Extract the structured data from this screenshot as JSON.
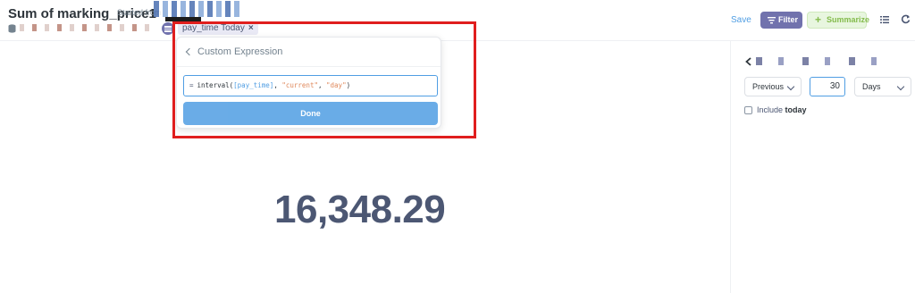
{
  "header": {
    "title": "Sum of marking_price1",
    "started_from": "Started from",
    "filter_pill": "pay_time Today",
    "filter_pill_close": "×",
    "save_label": "Save",
    "filter_label": "Filter",
    "summarize_label": "Summarize",
    "summarize_plus": "+",
    "colors": {
      "accent": "#509ee3",
      "filter": "#7172ad",
      "summarize": "#84bb4c"
    }
  },
  "popover": {
    "title": "Custom Expression",
    "expression": {
      "eq": "=",
      "fn": "interval(",
      "arg1": "[pay_time]",
      "sep1": ", ",
      "arg2": "\"current\"",
      "sep2": ", ",
      "arg3": "\"day\"",
      "close": ")"
    },
    "done_label": "Done"
  },
  "main": {
    "value": "16,348.29"
  },
  "sidebar": {
    "period_select": "Previous",
    "amount": "30",
    "unit_select": "Days",
    "include_label": "Include",
    "include_bold": "today"
  }
}
